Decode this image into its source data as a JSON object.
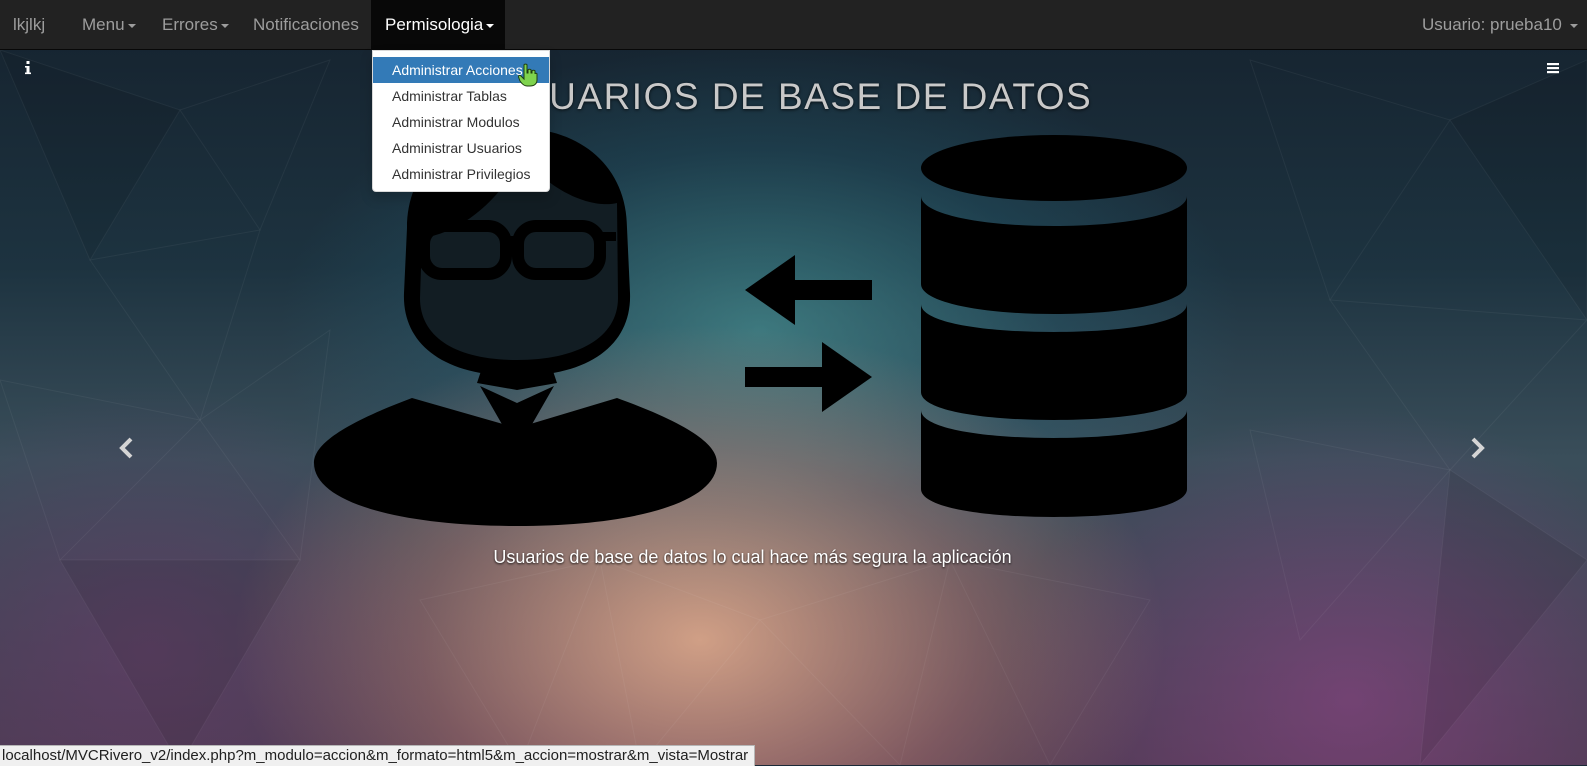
{
  "navbar": {
    "brand": "lkjlkj",
    "menu": "Menu",
    "errores": "Errores",
    "notificaciones": "Notificaciones",
    "permisologia": "Permisologia",
    "user": "Usuario: prueba10"
  },
  "dropdown": {
    "items": [
      {
        "label": "Administrar Acciones"
      },
      {
        "label": "Administrar Tablas"
      },
      {
        "label": "Administrar Modulos"
      },
      {
        "label": "Administrar Usuarios"
      },
      {
        "label": "Administrar Privilegios"
      }
    ],
    "selected_index": 0,
    "selected_color": "#337ab7"
  },
  "slide": {
    "title": "USUARIOS DE BASE DE DATOS",
    "description": "Usuarios de base de datos lo cual hace más segura la aplicación",
    "icons": [
      "user-icon",
      "arrows-exchange-icon",
      "database-icon"
    ]
  },
  "carousel": {
    "prev_icon": "chevron-left-icon",
    "next_icon": "chevron-right-icon",
    "info_icon": "info-icon",
    "menu_icon": "hamburger-icon"
  },
  "statusbar": {
    "url": "localhost/MVCRivero_v2/index.php?m_modulo=accion&m_formato=html5&m_accion=mostrar&m_vista=Mostrar"
  },
  "colors": {
    "navbar_bg": "#222222",
    "navbar_active_bg": "#080808",
    "navbar_text": "#9d9d9d"
  }
}
